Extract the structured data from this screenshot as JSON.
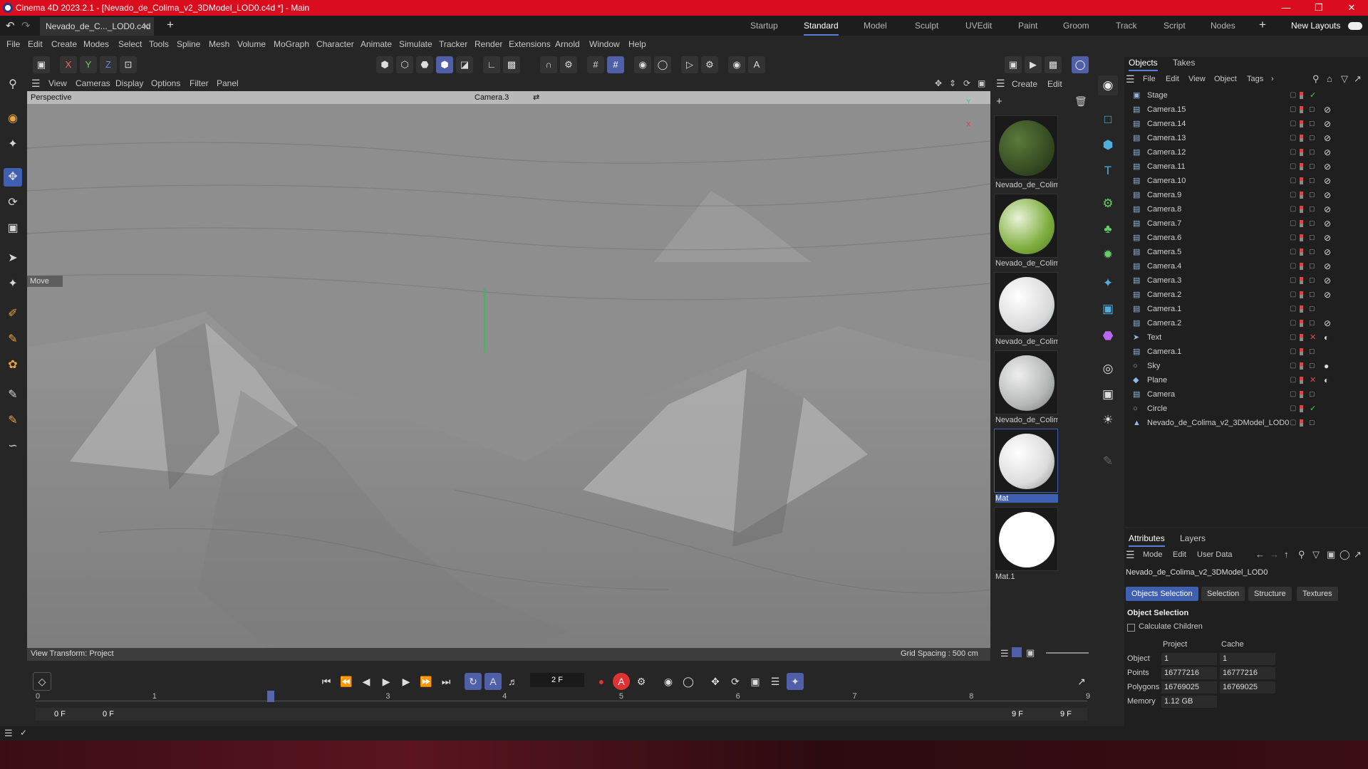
{
  "title_bar": {
    "title": "Cinema 4D 2023.2.1 - [Nevado_de_Colima_v2_3DModel_LOD0.c4d *] - Main"
  },
  "document_tab": {
    "label": "Nevado_de_C..._LOD0.c4d *"
  },
  "layouts": [
    "Startup",
    "Standard",
    "Model",
    "Sculpt",
    "UVEdit",
    "Paint",
    "Groom",
    "Track",
    "Script",
    "Nodes"
  ],
  "active_layout": "Standard",
  "new_layouts_label": "New Layouts",
  "menu": [
    "File",
    "Edit",
    "Create",
    "Modes",
    "Select",
    "Tools",
    "Spline",
    "Mesh",
    "Volume",
    "MoGraph",
    "Character",
    "Animate",
    "Simulate",
    "Tracker",
    "Render",
    "Extensions",
    "Arnold",
    "Window",
    "Help"
  ],
  "axis_buttons": [
    "X",
    "Y",
    "Z"
  ],
  "viewport_menu": [
    "View",
    "Cameras",
    "Display",
    "Options",
    "Filter",
    "Panel"
  ],
  "viewport": {
    "name": "Perspective",
    "camera": "Camera.3",
    "tool_label": "Move",
    "view_transform": "View Transform: Project",
    "grid_spacing": "Grid Spacing : 500 cm"
  },
  "material_menu": [
    "Create",
    "Edit"
  ],
  "materials": [
    {
      "label": "Nevado_de_Colim",
      "color": "#2f4a1e"
    },
    {
      "label": "Nevado_de_Colim",
      "color": "#8fbf4a"
    },
    {
      "label": "Nevado_de_Colim",
      "color": "#e8e8e8"
    },
    {
      "label": "Nevado_de_Colim",
      "color": "#bfc2c0"
    },
    {
      "label": "Mat",
      "color": "#f2f2f2"
    },
    {
      "label": "Mat.1",
      "color": "#ffffff"
    }
  ],
  "objects_panel": {
    "tabs": [
      "Objects",
      "Takes"
    ],
    "menu": [
      "File",
      "Edit",
      "View",
      "Object",
      "Tags"
    ],
    "items": [
      "Stage",
      "Camera.15",
      "Camera.14",
      "Camera.13",
      "Camera.12",
      "Camera.11",
      "Camera.10",
      "Camera.9",
      "Camera.8",
      "Camera.7",
      "Camera.6",
      "Camera.5",
      "Camera.4",
      "Camera.3",
      "Camera.2",
      "Camera.1",
      "Camera.2",
      "Text",
      "Camera.1",
      "Sky",
      "Plane",
      "Camera",
      "Circle",
      "Nevado_de_Colima_v2_3DModel_LOD0"
    ]
  },
  "attributes_panel": {
    "tabs": [
      "Attributes",
      "Layers"
    ],
    "menu": [
      "Mode",
      "Edit",
      "User Data"
    ],
    "object_name": "Nevado_de_Colima_v2_3DModel_LOD0",
    "subtabs": [
      "Objects Selection",
      "Selection",
      "Structure",
      "Textures"
    ],
    "section_title": "Object Selection",
    "checkbox_label": "Calculate Children",
    "col_headers": [
      "Project",
      "Cache"
    ],
    "rows": [
      {
        "label": "Object",
        "project": "1",
        "cache": "1"
      },
      {
        "label": "Points",
        "project": "16777216",
        "cache": "16777216"
      },
      {
        "label": "Polygons",
        "project": "16769025",
        "cache": "16769025"
      },
      {
        "label": "Memory",
        "project": "1.12 GB",
        "cache": ""
      }
    ]
  },
  "timeline": {
    "current_frame": "2 F",
    "ticks": [
      "0",
      "1",
      "2",
      "3",
      "4",
      "5",
      "6",
      "7",
      "8",
      "9"
    ],
    "start_a": "0 F",
    "start_b": "0 F",
    "end_a": "9 F",
    "end_b": "9 F"
  }
}
